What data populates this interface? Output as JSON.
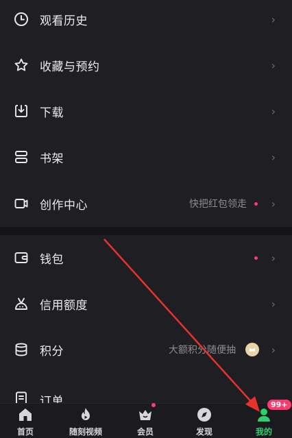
{
  "menu_top": [
    {
      "label": "观看历史",
      "icon": "clock-icon"
    },
    {
      "label": "收藏与预约",
      "icon": "star-icon"
    },
    {
      "label": "下载",
      "icon": "download-icon"
    },
    {
      "label": "书架",
      "icon": "bookshelf-icon"
    },
    {
      "label": "创作中心",
      "icon": "video-camera-icon",
      "hint": "快把红包领走"
    }
  ],
  "menu_bottom": [
    {
      "label": "钱包",
      "icon": "wallet-icon"
    },
    {
      "label": "信用额度",
      "icon": "credit-icon"
    },
    {
      "label": "积分",
      "icon": "points-icon",
      "hint": "大额积分随便抽"
    },
    {
      "label": "订单",
      "icon": "order-icon"
    }
  ],
  "chevron": "›",
  "tabs": [
    {
      "label": "首页",
      "icon": "home-icon"
    },
    {
      "label": "随刻视频",
      "icon": "flame-icon"
    },
    {
      "label": "会员",
      "icon": "crown-icon"
    },
    {
      "label": "发现",
      "icon": "compass-icon"
    },
    {
      "label": "我的",
      "icon": "profile-icon"
    }
  ],
  "badge": "99+",
  "colors": {
    "accent": "#2ecf6f",
    "dot": "#ff3a6e",
    "annotation_arrow": "#e8322e"
  }
}
